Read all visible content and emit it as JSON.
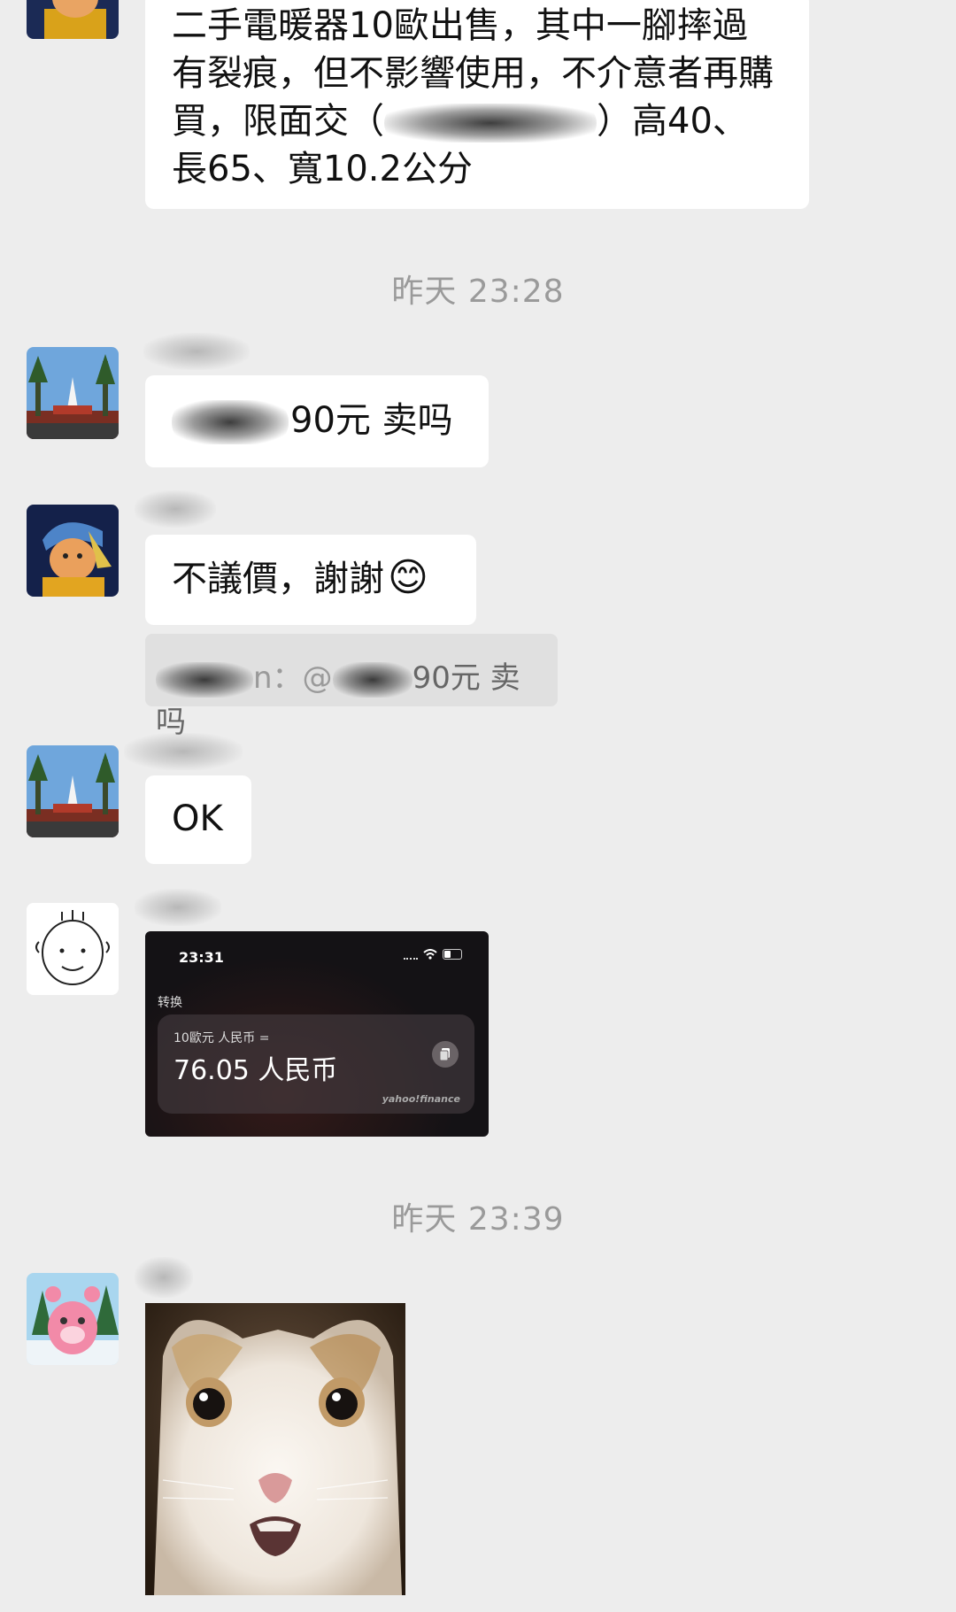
{
  "messages": {
    "heater_listing": "二手電暖器10歐出售，其中一腳摔過有裂痕，但不影響使用，不介意者再購買，限面交（",
    "heater_listing_tail": "）高40、長65、寬10.2公分",
    "ts1": "昨天 23:28",
    "offer": "90元 卖吗",
    "reply": "不議價，謝謝",
    "reply_emoji": "😊",
    "quote_text": "90元 卖吗",
    "quote_sep": "n：@",
    "ok": "OK",
    "ts2": "昨天 23:39"
  },
  "screenshot": {
    "time": "23:31",
    "section_label": "转换",
    "query": "10歐元 人民币 =",
    "result": "76.05 人民币",
    "provider": "yahoo!finance"
  },
  "colors": {
    "background": "#ededed",
    "bubble": "#ffffff",
    "timestamp": "#9a9a9a",
    "quote_bg": "#e0e0e0"
  }
}
